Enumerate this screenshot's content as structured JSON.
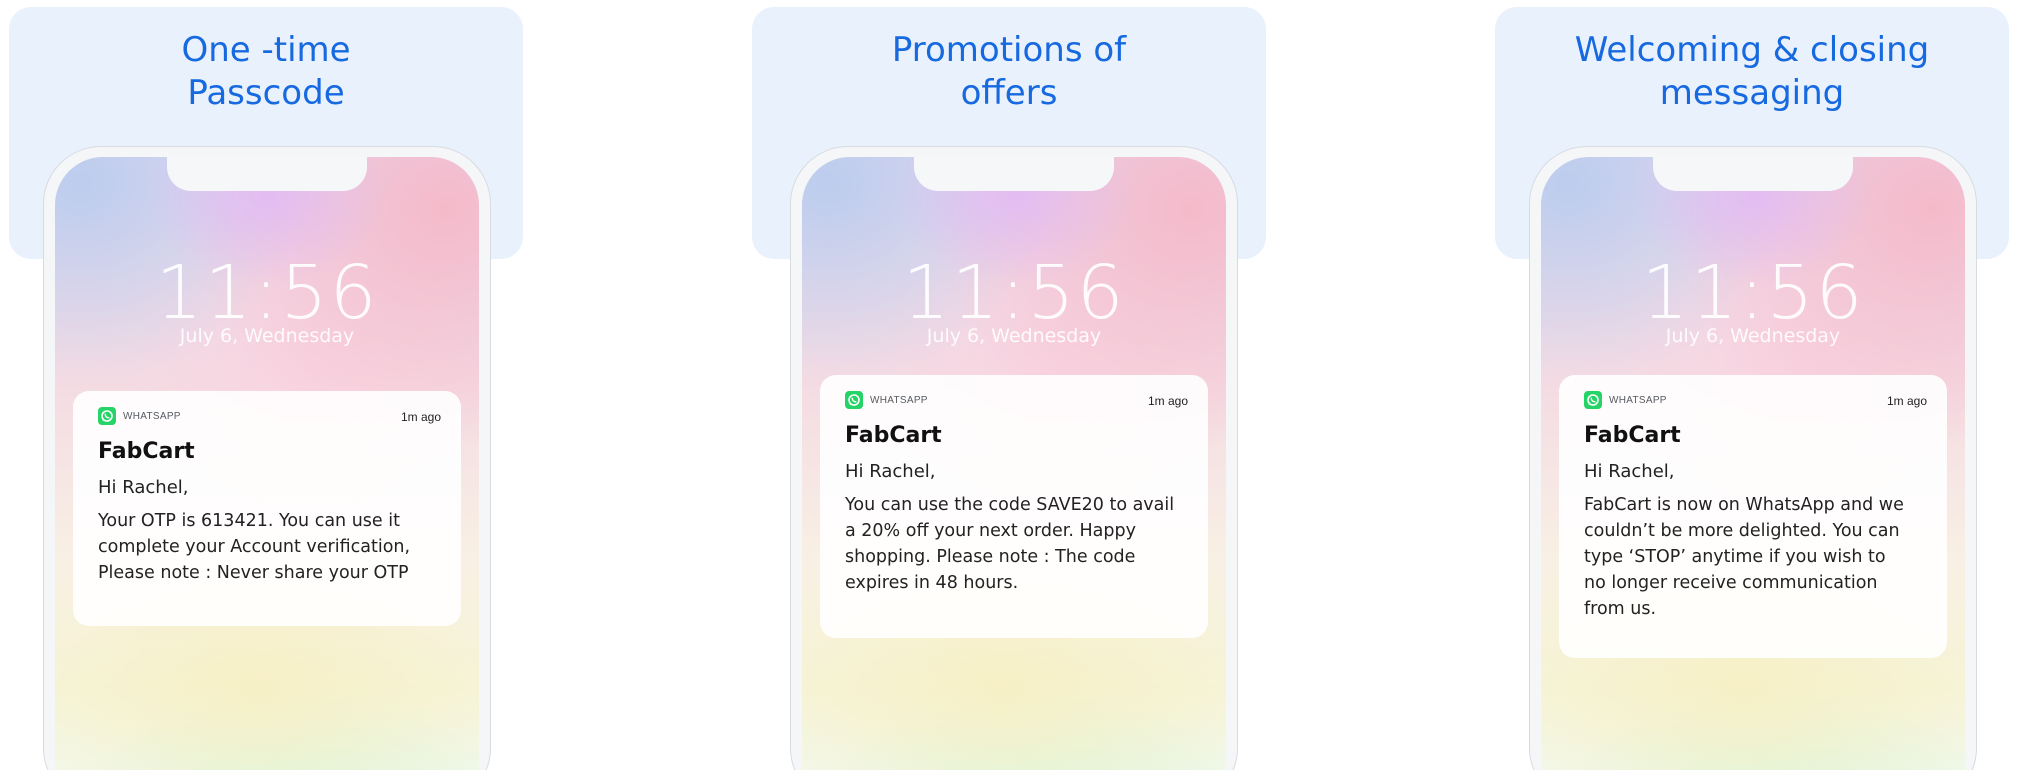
{
  "panels": [
    {
      "title_line1": "One -time",
      "title_line2": "Passcode",
      "clock": "11:56",
      "date": "July 6, Wednesday",
      "notification": {
        "app": "WHATSAPP",
        "time_ago": "1m ago",
        "sender": "FabCart",
        "greeting": "Hi Rachel,",
        "body": "Your OTP is 613421. You can use it\ncomplete your Account verification,\nPlease note : Never share your OTP"
      }
    },
    {
      "title_line1": "Promotions of",
      "title_line2": "offers",
      "clock": "11:56",
      "date": "July 6, Wednesday",
      "notification": {
        "app": "WHATSAPP",
        "time_ago": "1m ago",
        "sender": "FabCart",
        "greeting": "Hi Rachel,",
        "body": "You can use the code SAVE20 to avail\na 20% off your next order. Happy\nshopping. Please note : The code\nexpires in 48 hours."
      }
    },
    {
      "title_line1": "Welcoming & closing",
      "title_line2": "messaging",
      "clock": "11:56",
      "date": "July 6, Wednesday",
      "notification": {
        "app": "WHATSAPP",
        "time_ago": "1m ago",
        "sender": "FabCart",
        "greeting": "Hi Rachel,",
        "body": "FabCart is now on WhatsApp and we\ncouldn’t be more delighted. You can\ntype ‘STOP’ anytime if you wish to\nno longer receive communication\nfrom us."
      }
    }
  ],
  "colors": {
    "title_blue": "#1769e0",
    "title_card_bg": "#e9f1fd",
    "whatsapp_green": "#25d366"
  }
}
